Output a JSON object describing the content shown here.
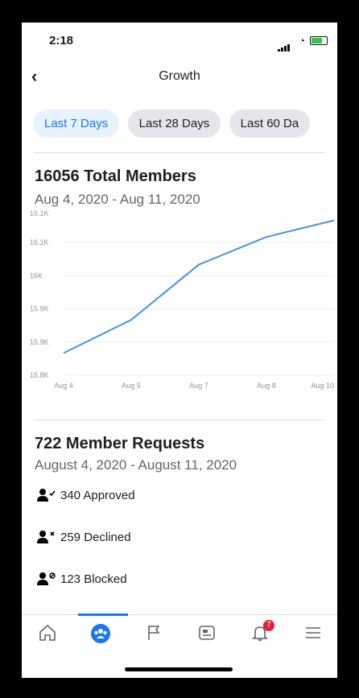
{
  "status": {
    "time": "2:18"
  },
  "header": {
    "title": "Growth",
    "back_label": "‹"
  },
  "filters": [
    "Last 7 Days",
    "Last 28 Days",
    "Last 60 Da"
  ],
  "summary": {
    "total_label": "16056 Total Members",
    "date_range": "Aug 4, 2020 - Aug 11, 2020"
  },
  "chart_data": {
    "type": "line",
    "x": [
      "Aug 4",
      "Aug 5",
      "Aug 7",
      "Aug 8",
      "Aug 10"
    ],
    "series": [
      {
        "values": [
          15.84,
          15.9,
          16.0,
          16.05,
          16.08
        ]
      }
    ],
    "y_tick_labels": [
      "16.1K",
      "16.1K",
      "16K",
      "15.9K",
      "15.9K",
      "15.8K"
    ],
    "ylim": [
      15.8,
      16.1
    ],
    "grid": true,
    "line_color": "#4a90e2"
  },
  "requests": {
    "title": "722 Member Requests",
    "date_range": "August 4, 2020 - August 11, 2020",
    "items": [
      {
        "label": "340 Approved",
        "icon": "person-check-icon"
      },
      {
        "label": "259 Declined",
        "icon": "person-x-icon"
      },
      {
        "label": "123 Blocked",
        "icon": "person-blocked-icon"
      }
    ]
  },
  "tabbar": {
    "items": [
      "home-icon",
      "groups-icon",
      "flag-icon",
      "feed-icon",
      "bell-icon",
      "menu-icon"
    ],
    "notifications_badge": "7"
  }
}
